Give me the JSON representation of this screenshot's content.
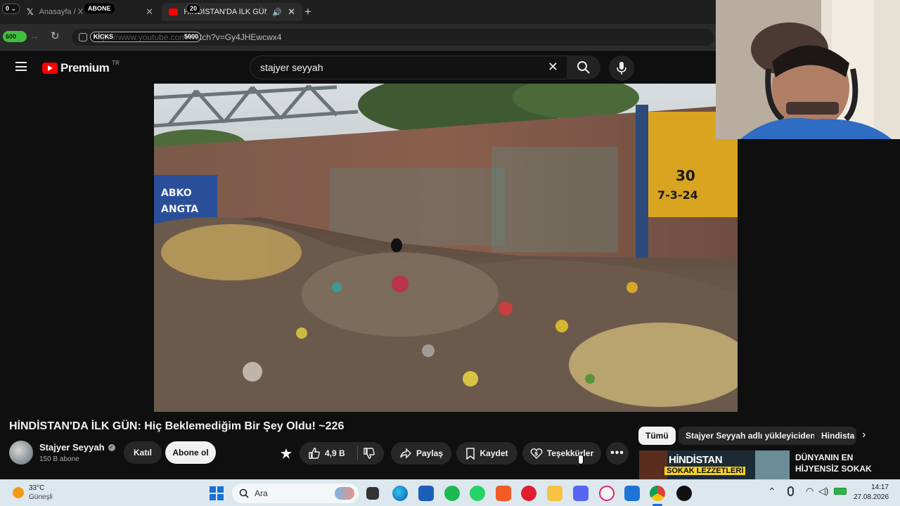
{
  "browser": {
    "tabs": [
      {
        "label": "Anasayfa / X",
        "active": false
      },
      {
        "label": "HİNDİSTAN'DA İLK GÜN: Hiç",
        "active": true
      }
    ],
    "url": "https://www.youtube.com/watch?v=Gy4JHEwcwx4"
  },
  "overlay": {
    "badge_0": "0",
    "badge_abone": "ABONE",
    "badge_20": "20",
    "badge_600": "600",
    "badge_kicks": "KİCKS",
    "badge_5000": "5000"
  },
  "youtube": {
    "logo_text": "Premium",
    "region": "TR",
    "search_value": "stajyer seyyah"
  },
  "video_scene": {
    "wall_sign_1": "30",
    "wall_sign_2": "7-3-24",
    "poster_text_1": "ABKO",
    "poster_text_2": "ANGTA"
  },
  "video_info": {
    "title": "HİNDİSTAN'DA İLK GÜN: Hiç Beklemediğim Bir Şey Oldu! ~226",
    "channel_name": "Stajyer Seyyah",
    "subscribers": "150 B abone",
    "join_label": "Katıl",
    "subscribe_label": "Abone ol",
    "like_count": "4,9 B",
    "share_label": "Paylaş",
    "save_label": "Kaydet",
    "thanks_label": "Teşekkürler"
  },
  "side_chips": [
    "Tümü",
    "Stajyer Seyyah adlı yükleyiciden",
    "Hindista"
  ],
  "recommendation": {
    "thumb_line1": "HİNDİSTAN",
    "thumb_line2": "SOKAK LEZZETLERİ",
    "title_line1": "DÜNYANIN EN",
    "title_line2": "HİJYENSİZ SOKAK"
  },
  "taskbar": {
    "temperature": "33°C",
    "weather": "Güneşli",
    "search_placeholder": "Ara",
    "time": "14:17",
    "date": "27.08.2026"
  },
  "colors": {
    "youtube_red": "#ff0000",
    "dark_bg": "#0f0f0f",
    "pill_bg": "#272727",
    "taskbar_bg": "#dde7ee"
  }
}
